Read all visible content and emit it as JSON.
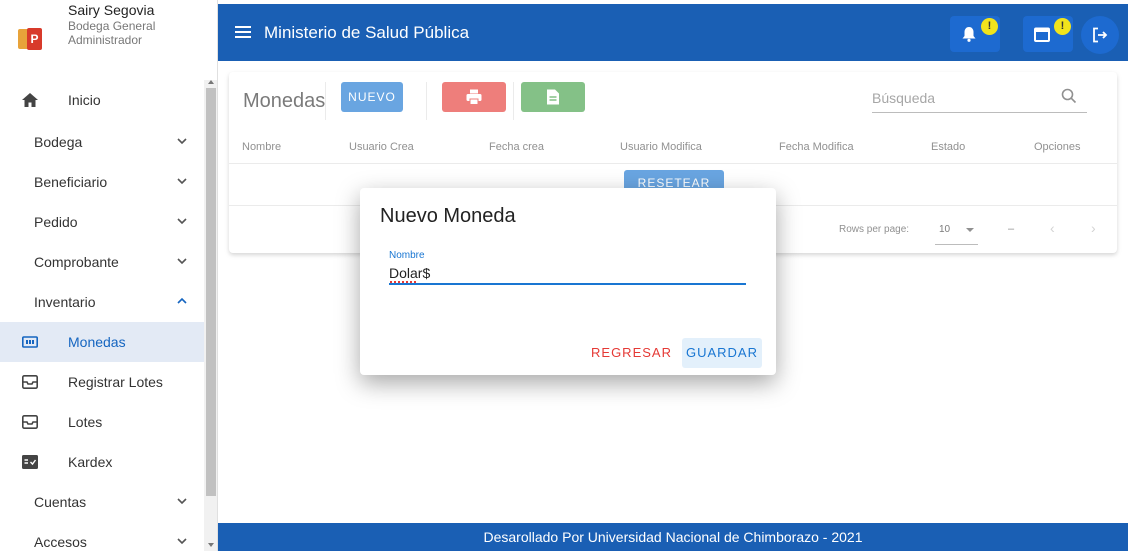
{
  "user": {
    "name": "Sairy Segovia",
    "location": "Bodega General",
    "role": "Administrador"
  },
  "sidebar": {
    "items": [
      {
        "label": "Inicio",
        "icon": "home-icon"
      },
      {
        "label": "Bodega",
        "icon": "chevron-down-icon"
      },
      {
        "label": "Beneficiario",
        "icon": "chevron-down-icon"
      },
      {
        "label": "Pedido",
        "icon": "chevron-down-icon"
      },
      {
        "label": "Comprobante",
        "icon": "chevron-down-icon"
      },
      {
        "label": "Inventario",
        "icon": "chevron-up-icon"
      },
      {
        "label": "Monedas",
        "icon": "currency-icon"
      },
      {
        "label": "Registrar Lotes",
        "icon": "inbox-icon"
      },
      {
        "label": "Lotes",
        "icon": "inbox-icon"
      },
      {
        "label": "Kardex",
        "icon": "kardex-icon"
      },
      {
        "label": "Cuentas",
        "icon": "chevron-down-icon"
      },
      {
        "label": "Accesos",
        "icon": "chevron-down-icon"
      }
    ],
    "active": "Monedas"
  },
  "topbar": {
    "title": "Ministerio de Salud Pública",
    "notification_badge": "!",
    "calendar_badge": "!"
  },
  "table": {
    "title": "Monedas",
    "new_label": "NUEVO",
    "search_placeholder": "Búsqueda",
    "columns": [
      "Nombre",
      "Usuario Crea",
      "Fecha crea",
      "Usuario Modifica",
      "Fecha Modifica",
      "Estado",
      "Opciones"
    ],
    "reset_label": "RESETEAR",
    "rows_per_page_label": "Rows per page:",
    "rows_per_page_value": "10",
    "range_text": "–"
  },
  "dialog": {
    "title": "Nuevo Moneda",
    "field_label": "Nombre",
    "field_value": "Dolar$",
    "back_label": "REGRESAR",
    "save_label": "GUARDAR"
  },
  "footer": {
    "text": "Desarollado Por Universidad Nacional de Chimborazo - 2021"
  },
  "colors": {
    "primary": "#1a5fb4",
    "accent_blue": "#1976d2",
    "danger": "#e53935",
    "success": "#43a047",
    "badge": "#f1e41c"
  }
}
